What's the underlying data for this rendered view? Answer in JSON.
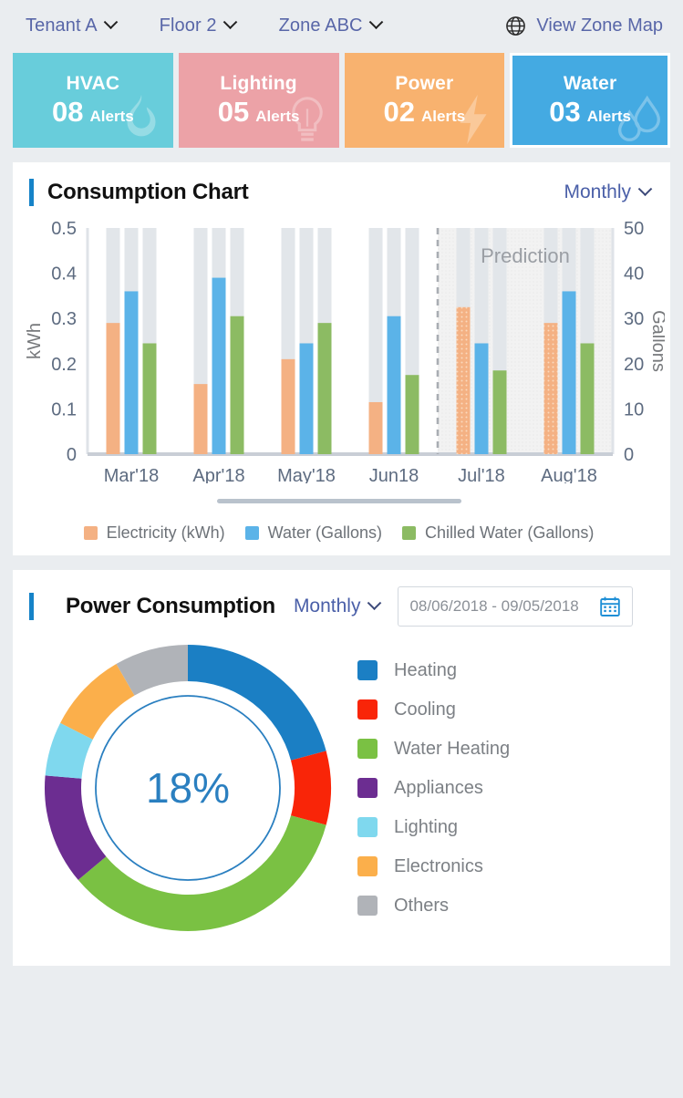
{
  "topbar": {
    "filters": [
      {
        "label": "Tenant A",
        "name": "tenant"
      },
      {
        "label": "Floor 2",
        "name": "floor"
      },
      {
        "label": "Zone ABC",
        "name": "zone"
      }
    ],
    "zone_map_link": "View Zone Map",
    "globe_icon": "globe-icon"
  },
  "alerts": [
    {
      "title": "HVAC",
      "count": "08",
      "unit": "Alerts",
      "color": "#68cddb",
      "icon": "flame-icon",
      "selected": false
    },
    {
      "title": "Lighting",
      "count": "05",
      "unit": "Alerts",
      "color": "#eca2a7",
      "icon": "bulb-icon",
      "selected": false
    },
    {
      "title": "Power",
      "count": "02",
      "unit": "Alerts",
      "color": "#f8b26f",
      "icon": "bolt-icon",
      "selected": false
    },
    {
      "title": "Water",
      "count": "03",
      "unit": "Alerts",
      "color": "#44aae2",
      "icon": "droplet-icon",
      "selected": true
    }
  ],
  "consumption": {
    "title": "Consumption Chart",
    "period": "Monthly",
    "accent_color": "#1683c8",
    "chevron_icon": "chevron-down-icon",
    "scrollbar": "horizontal-scrollbar"
  },
  "power": {
    "title": "Power Consumption",
    "period": "Monthly",
    "date_range": "08/06/2018 - 09/05/2018",
    "calendar_icon": "calendar-icon",
    "chevron_icon": "chevron-down-icon",
    "center_value": "18%"
  },
  "chart_data": [
    {
      "type": "bar",
      "title": "Consumption Chart",
      "categories": [
        "Mar'18",
        "Apr'18",
        "May'18",
        "Jun18",
        "Jul'18",
        "Aug'18"
      ],
      "series": [
        {
          "name": "Electricity (kWh)",
          "color": "#f4b183",
          "values": [
            0.29,
            0.155,
            0.21,
            0.115,
            0.325,
            0.29
          ]
        },
        {
          "name": "Water (Gallons)",
          "color": "#5bb3e8",
          "values": [
            0.36,
            0.39,
            0.245,
            0.305,
            0.245,
            0.36
          ]
        },
        {
          "name": "Chilled Water (Gallons)",
          "color": "#8cbb63",
          "values": [
            0.245,
            0.305,
            0.29,
            0.175,
            0.185,
            0.245
          ]
        }
      ],
      "ylabel": "kWh",
      "y_ticks": [
        "0",
        "0.1",
        "0.2",
        "0.3",
        "0.4",
        "0.5"
      ],
      "ylim": [
        0,
        0.5
      ],
      "y2label": "Gallons",
      "y2_ticks": [
        "0",
        "10",
        "20",
        "30",
        "40",
        "50"
      ],
      "y2lim": [
        0,
        50
      ],
      "track_color": "#e2e6ea",
      "prediction_label": "Prediction",
      "prediction_from_category": "Jul'18",
      "prediction_bg": "#f2f2f2",
      "grid": false,
      "legend_position": "bottom"
    },
    {
      "type": "pie",
      "title": "Power Consumption",
      "center_label": "18%",
      "labels": [
        "Heating",
        "Cooling",
        "Water Heating",
        "Appliances",
        "Lighting",
        "Electronics",
        "Others"
      ],
      "colors": [
        "#1b7fc4",
        "#f92508",
        "#7ac143",
        "#6c2d91",
        "#7fd8ee",
        "#fbaf4b",
        "#b0b3b8"
      ],
      "values": [
        20.8,
        8.3,
        34.7,
        12.5,
        6.1,
        9.2,
        8.4
      ],
      "angles_deg": [
        75,
        30,
        125,
        45,
        22,
        33,
        30
      ]
    }
  ]
}
